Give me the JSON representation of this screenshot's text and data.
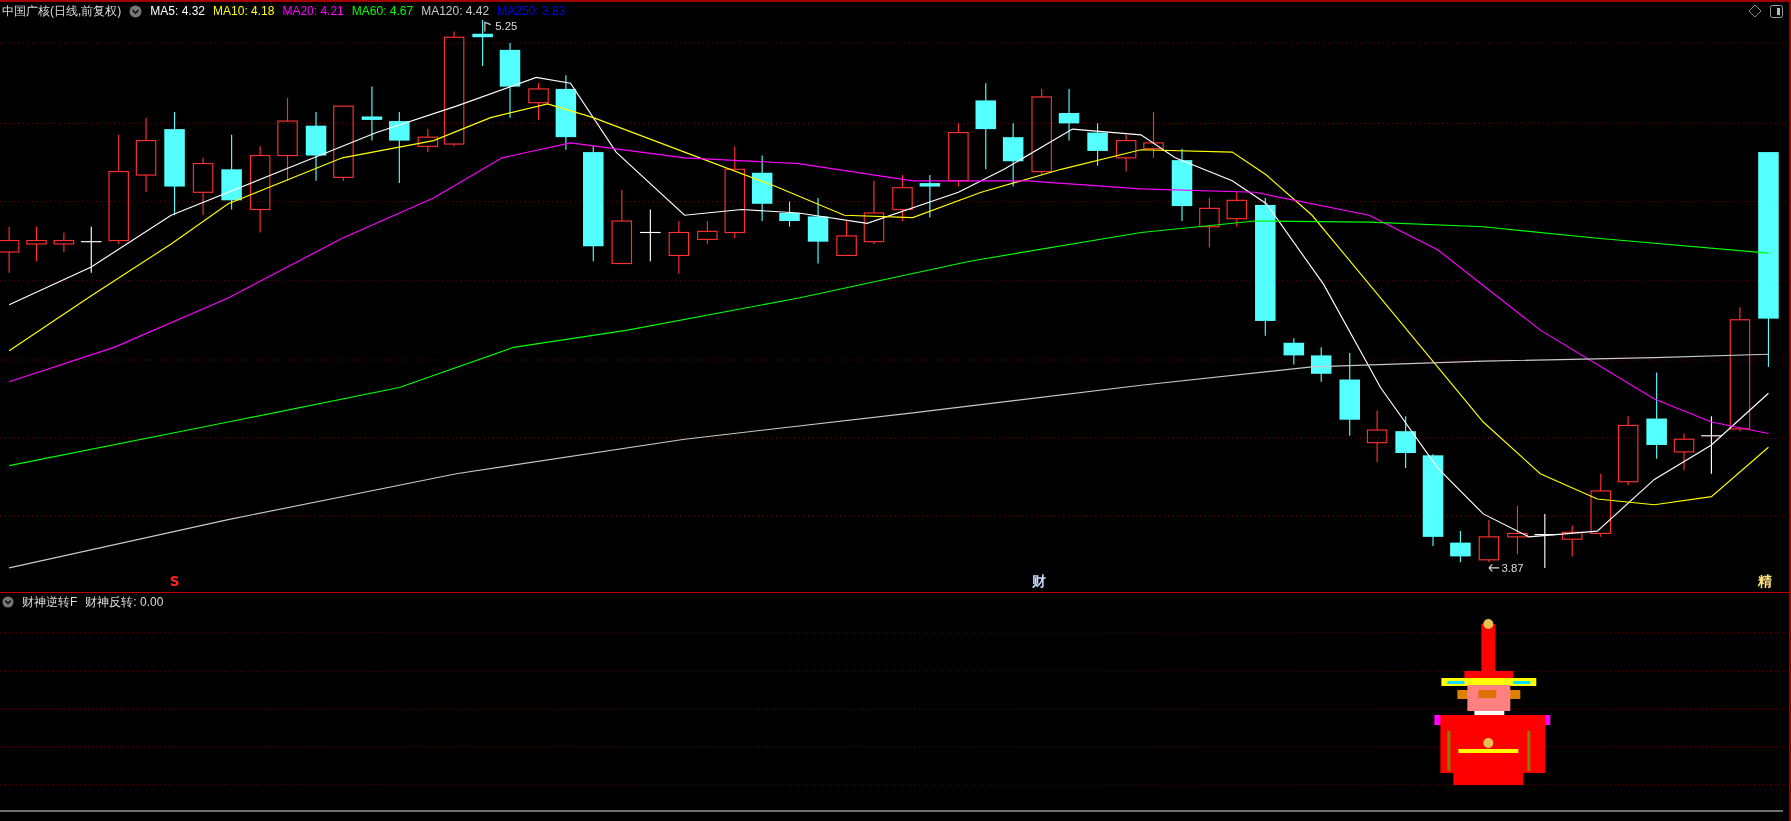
{
  "header": {
    "title": "中国广核(日线,前复权)",
    "moving_averages": [
      {
        "label": "MA5: 4.32",
        "color": "#ffffff"
      },
      {
        "label": "MA10: 4.18",
        "color": "#ffff00"
      },
      {
        "label": "MA20: 4.21",
        "color": "#ff00ff"
      },
      {
        "label": "MA60: 4.67",
        "color": "#00ff00"
      },
      {
        "label": "MA120: 4.42",
        "color": "#c8c8c8"
      },
      {
        "label": "MA250: 3.83",
        "color": "#0000ff"
      }
    ]
  },
  "price_chart": {
    "high_label": "5.25",
    "low_label": "3.87",
    "signals": [
      {
        "text": "S",
        "color": "#ff2020"
      },
      {
        "text": "财",
        "color": "#c8d8ff"
      },
      {
        "text": "精",
        "color": "#ffe080"
      }
    ]
  },
  "indicator": {
    "name": "财神逆转F",
    "reading": "财神反转: 0.00"
  }
}
